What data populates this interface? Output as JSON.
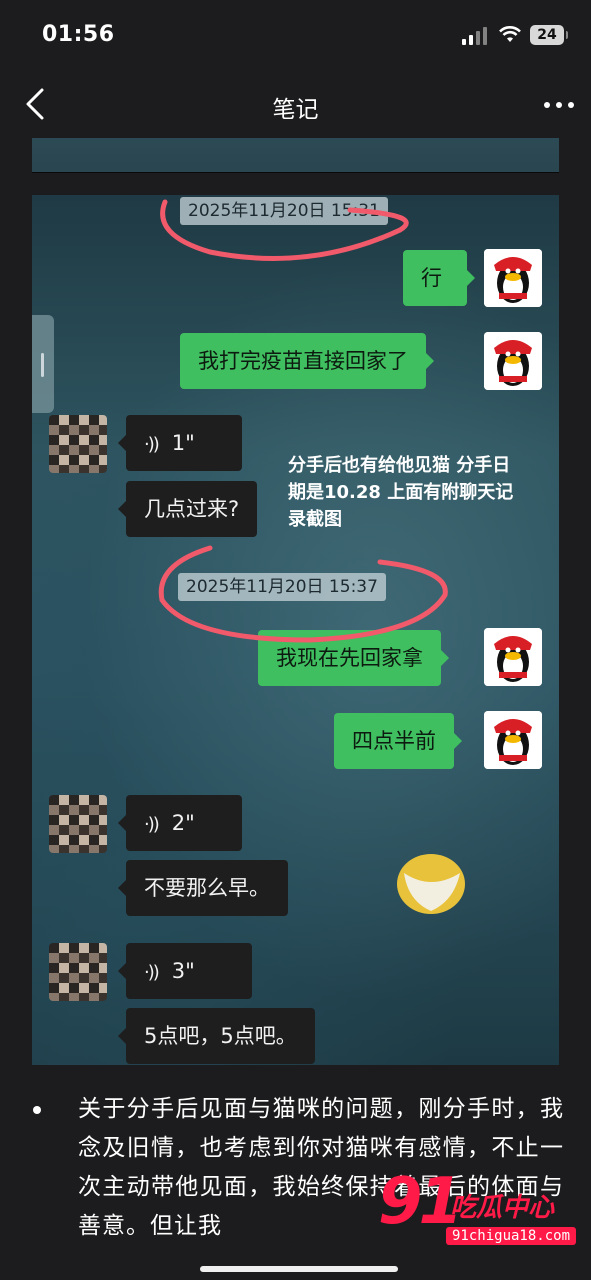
{
  "status_bar": {
    "time": "01:56",
    "battery": "24"
  },
  "nav": {
    "title": "笔记"
  },
  "chat": {
    "timestamps": [
      "2025年11月20日 15:31",
      "2025年11月20日 15:37"
    ],
    "messages": [
      {
        "side": "right",
        "text": "行"
      },
      {
        "side": "right",
        "text": "我打完疫苗直接回家了"
      },
      {
        "side": "left",
        "type": "voice",
        "duration": "1\""
      },
      {
        "side": "left",
        "text": "几点过来?"
      },
      {
        "side": "right",
        "text": "我现在先回家拿"
      },
      {
        "side": "right",
        "text": "四点半前"
      },
      {
        "side": "left",
        "type": "voice",
        "duration": "2\""
      },
      {
        "side": "left",
        "text": "不要那么早。"
      },
      {
        "side": "left",
        "type": "voice",
        "duration": "3\""
      },
      {
        "side": "left",
        "text": "5点吧，5点吧。"
      }
    ],
    "annotation": "分手后也有给他见猫 分手日期是10.28 上面有附聊天记录截图"
  },
  "note": {
    "paragraph": "关于分手后见面与猫咪的问题，刚分手时，我念及旧情，也考虑到你对猫咪有感情，不止一次主动带他见面，我始终保持着最后的体面与善意。但让我"
  },
  "watermark": {
    "logo": "91",
    "name": "吃瓜中心",
    "url": "91chigua18.com"
  },
  "colors": {
    "bubble_green": "#3fbf5f",
    "bubble_dark": "#1e1e1e",
    "circle_red": "#f05a6a",
    "watermark": "#ff1a47"
  }
}
